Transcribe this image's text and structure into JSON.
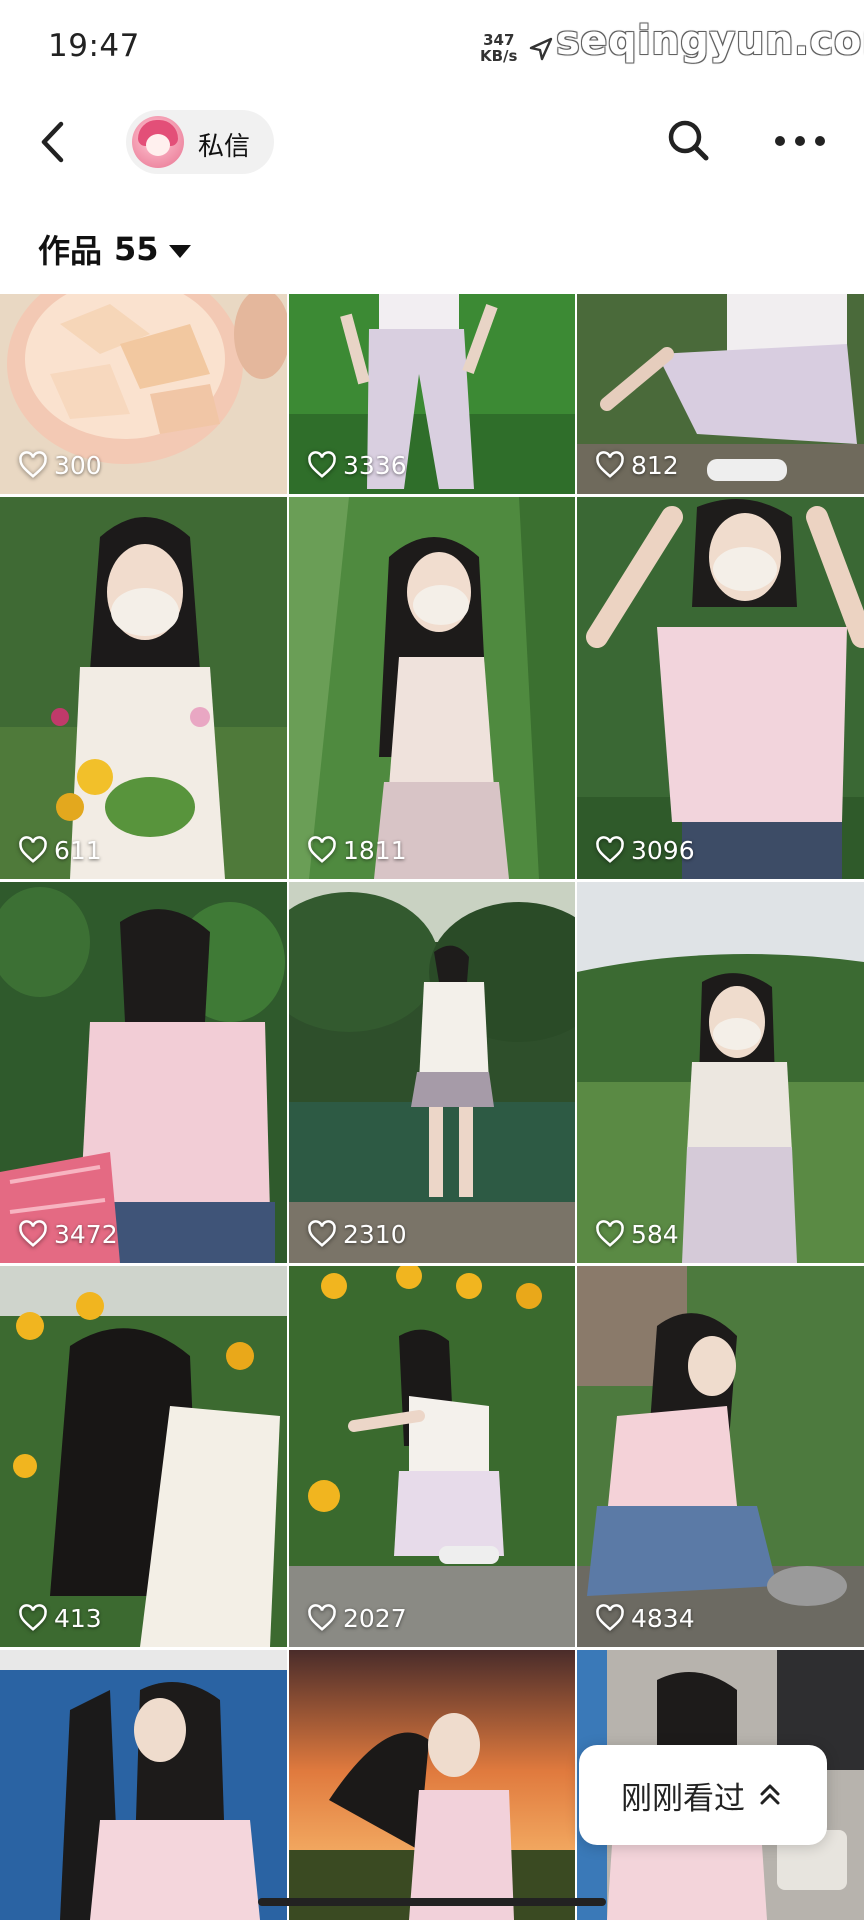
{
  "status_bar": {
    "time": "19:47",
    "speed_value": "347",
    "speed_unit": "KB/s",
    "watermark": "seqingyun.com"
  },
  "nav": {
    "dm_label": "私信"
  },
  "works": {
    "label": "作品",
    "count": "55"
  },
  "posts": [
    {
      "likes": "300",
      "scene": "fruit bowl"
    },
    {
      "likes": "3336",
      "scene": "rice field"
    },
    {
      "likes": "812",
      "scene": "squatting in garden"
    },
    {
      "likes": "611",
      "scene": "flowers portrait"
    },
    {
      "likes": "1811",
      "scene": "corn field"
    },
    {
      "likes": "3096",
      "scene": "pink top portrait"
    },
    {
      "likes": "3472",
      "scene": "basket back view"
    },
    {
      "likes": "2310",
      "scene": "lakeside"
    },
    {
      "likes": "584",
      "scene": "hillside field"
    },
    {
      "likes": "413",
      "scene": "sunflowers long hair"
    },
    {
      "likes": "2027",
      "scene": "sunflowers squatting"
    },
    {
      "likes": "4834",
      "scene": "village crouching"
    },
    {
      "likes": "",
      "scene": "blue curtain"
    },
    {
      "likes": "",
      "scene": "sunset field"
    },
    {
      "likes": "",
      "scene": "indoor"
    }
  ],
  "recent": {
    "label": "刚刚看过"
  },
  "icons": {
    "back": "chevron-left-icon",
    "search": "search-icon",
    "more": "more-dots-icon",
    "like": "heart-icon",
    "recent": "double-chevron-up-icon"
  }
}
